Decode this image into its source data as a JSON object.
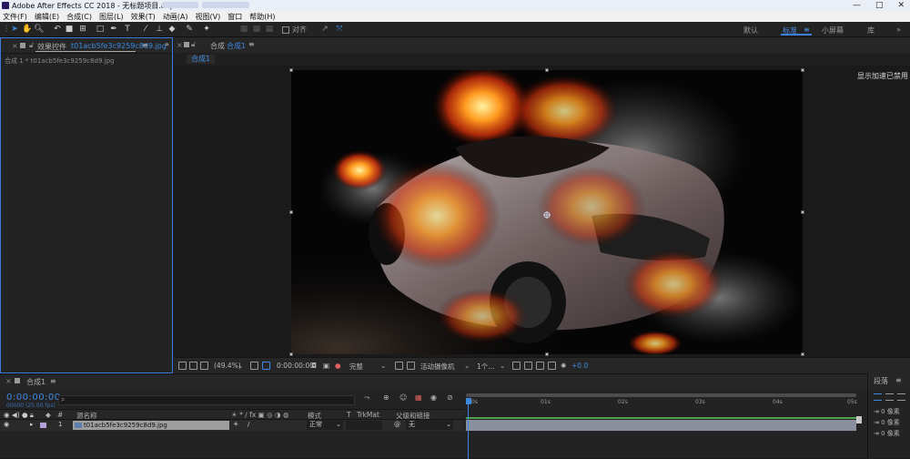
{
  "window": {
    "title": "Adobe After Effects CC 2018 - 无标题项目.aep *",
    "controls": [
      "—",
      "□",
      "✕"
    ]
  },
  "menu": [
    "文件(F)",
    "编辑(E)",
    "合成(C)",
    "图层(L)",
    "效果(T)",
    "动画(A)",
    "视图(V)",
    "窗口",
    "帮助(H)"
  ],
  "toolbar": {
    "snap_label": "对齐",
    "workspaces": [
      {
        "label": "默认",
        "active": false
      },
      {
        "label": "标准",
        "active": true
      },
      {
        "label": "小屏幕",
        "active": false
      },
      {
        "label": "库",
        "active": false
      }
    ],
    "more": "»"
  },
  "left_panel": {
    "tab_prefix": "效果控件",
    "tab_file": "t01acb5fe3c9259c8d9.jpg",
    "menu": "≡",
    "path": "合成 1 * t01acb5fe3c9259c8d9.jpg"
  },
  "comp_panel": {
    "tab_prefix": "合成",
    "tab_comp": "合成1",
    "menu": "≡",
    "flow_crumb": "合成1",
    "gpu_note": "显示加速已禁用"
  },
  "viewer_bar": {
    "zoom": "(49.4%)",
    "timecode": "0:00:00:00",
    "resolution": "完整",
    "camera": "活动摄像机",
    "views": "1个...",
    "exposure": "+0.0"
  },
  "timeline": {
    "tab_label": "合成1",
    "menu": "≡",
    "timecode": "0:00:00:00",
    "frame_info": "00000 (25.00 fps)",
    "headers": {
      "source_name": "源名称",
      "mode": "模式",
      "t": "T",
      "trkmat": "TrkMat",
      "parent": "父级和链接"
    },
    "ruler_ticks": [
      "0s",
      "01s",
      "02s",
      "03s",
      "04s",
      "05s"
    ],
    "layer": {
      "num": "1",
      "name": "t01acb5fe3c9259c8d9.jpg",
      "mode": "正常",
      "parent": "无"
    }
  },
  "paragraph_panel": {
    "tab_label": "段落",
    "menu": "≡",
    "indent_rows": [
      "0 像素",
      "0 像素",
      "0 像素"
    ]
  },
  "colors": {
    "accent": "#3d89e0",
    "panel": "#232323",
    "viewer_bg": "#1a1a1a",
    "layer_label": "#b5a0d8",
    "work_area": "#4fa34a"
  }
}
